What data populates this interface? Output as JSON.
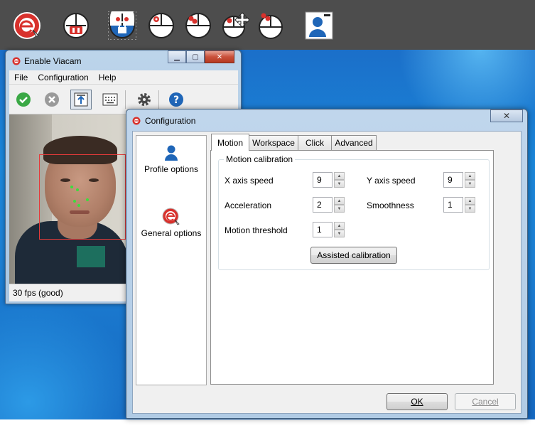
{
  "main_window": {
    "title": "Enable Viacam",
    "menu": [
      "File",
      "Configuration",
      "Help"
    ],
    "status": "30 fps (good)"
  },
  "config": {
    "title": "Configuration",
    "sidebar": [
      "Profile options",
      "General options"
    ],
    "tabs": [
      "Motion",
      "Workspace",
      "Click",
      "Advanced"
    ],
    "group_title": "Motion calibration",
    "fields": {
      "x_axis_speed": {
        "label": "X axis speed",
        "value": "9"
      },
      "y_axis_speed": {
        "label": "Y axis speed",
        "value": "9"
      },
      "acceleration": {
        "label": "Acceleration",
        "value": "2"
      },
      "smoothness": {
        "label": "Smoothness",
        "value": "1"
      },
      "motion_threshold": {
        "label": "Motion threshold",
        "value": "1"
      }
    },
    "assisted_calibration": "Assisted calibration",
    "ok": "OK",
    "cancel": "Cancel"
  },
  "colors": {
    "toolbar_bg": "#4d4d4d",
    "accent_red": "#d8312c",
    "accent_blue": "#1f66b8"
  },
  "icons": [
    "app-logo-icon",
    "pause-mouse-icon",
    "lock-mouse-icon",
    "left-click-icon",
    "double-click-icon",
    "drag-click-icon",
    "right-click-icon",
    "profile-icon",
    "check-icon",
    "cancel-icon",
    "tracker-icon",
    "keyboard-icon",
    "gear-icon",
    "help-icon"
  ]
}
